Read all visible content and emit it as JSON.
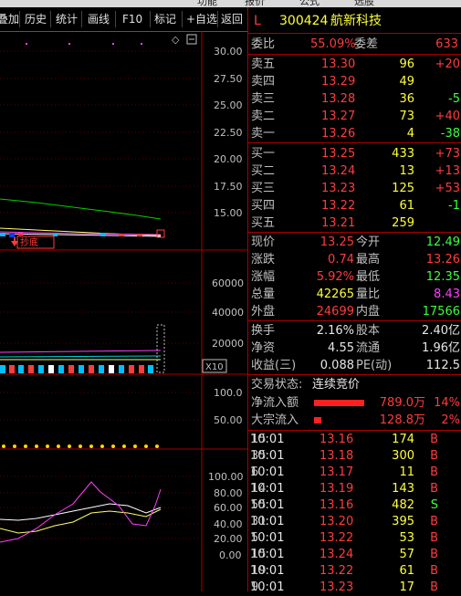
{
  "menu": {
    "items": [
      "功能",
      "报价",
      "公式",
      "选股"
    ]
  },
  "toolbar": {
    "buttons": [
      "叠加",
      "历史",
      "统计",
      "画线",
      "F10",
      "标记",
      "+自选",
      "返回"
    ]
  },
  "chart": {
    "price_ticks": [
      "30.00",
      "27.50",
      "25.00",
      "22.50",
      "20.00",
      "17.50",
      "15.00"
    ],
    "volume_ticks": [
      "60000",
      "40000",
      "20000"
    ],
    "volume_unit": "X10",
    "osc1_ticks": [
      "100.0",
      "50.00"
    ],
    "osc2_ticks": [
      "100.00",
      "80.00",
      "60.00",
      "40.00",
      "20.00",
      "0.00"
    ],
    "copy_bottom_label": "抄底",
    "colors": {
      "green_line": "#00d000",
      "yellow_line": "#ffff66",
      "magenta_line": "#ff40ff",
      "white_line": "#ffffff"
    }
  },
  "stock": {
    "flag": "L",
    "code": "300424",
    "name": "航新科技"
  },
  "order": {
    "weibi_label": "委比",
    "weibi_value": "55.09%",
    "weicha_label": "委差",
    "weicha_value": "633",
    "asks": [
      {
        "label": "卖五",
        "price": "13.30",
        "vol": "96",
        "chg": "+20"
      },
      {
        "label": "卖四",
        "price": "13.29",
        "vol": "49",
        "chg": ""
      },
      {
        "label": "卖三",
        "price": "13.28",
        "vol": "36",
        "chg": "-5"
      },
      {
        "label": "卖二",
        "price": "13.27",
        "vol": "73",
        "chg": "+40"
      },
      {
        "label": "卖一",
        "price": "13.26",
        "vol": "4",
        "chg": "-38"
      }
    ],
    "bids": [
      {
        "label": "买一",
        "price": "13.25",
        "vol": "433",
        "chg": "+73"
      },
      {
        "label": "买二",
        "price": "13.24",
        "vol": "13",
        "chg": "+13"
      },
      {
        "label": "买三",
        "price": "13.23",
        "vol": "125",
        "chg": "+53"
      },
      {
        "label": "买四",
        "price": "13.22",
        "vol": "61",
        "chg": "-1"
      },
      {
        "label": "买五",
        "price": "13.21",
        "vol": "259",
        "chg": ""
      }
    ]
  },
  "quote": [
    {
      "l1": "现价",
      "v1": "13.25",
      "l2": "今开",
      "v2": "12.49"
    },
    {
      "l1": "涨跌",
      "v1": "0.74",
      "l2": "最高",
      "v2": "13.26"
    },
    {
      "l1": "涨幅",
      "v1": "5.92%",
      "l2": "最低",
      "v2": "12.35"
    },
    {
      "l1": "总量",
      "v1": "42265",
      "l2": "量比",
      "v2": "8.43"
    },
    {
      "l1": "外盘",
      "v1": "24699",
      "l2": "内盘",
      "v2": "17566"
    }
  ],
  "fundamentals": [
    {
      "l1": "换手",
      "v1": "2.16%",
      "l2": "股本",
      "v2": "2.40亿"
    },
    {
      "l1": "净资",
      "v1": "4.55",
      "l2": "流通",
      "v2": "1.96亿"
    },
    {
      "l1": "收益(三)",
      "v1": "0.088",
      "l2": "PE(动)",
      "v2": "112.5"
    }
  ],
  "status": {
    "label": "交易状态:",
    "value": "连续竞价"
  },
  "flows": [
    {
      "label": "净流入额",
      "amount": "789.0万",
      "pct": "14%",
      "bar": 0.14
    },
    {
      "label": "大宗流入",
      "amount": "128.8万",
      "pct": "2%",
      "bar": 0.02
    }
  ],
  "ticks": [
    {
      "time": "10:01",
      "price": "13.16",
      "vol": "174",
      "side": "B",
      "n": "15"
    },
    {
      "time": "10:01",
      "price": "13.18",
      "vol": "300",
      "side": "B",
      "n": "35"
    },
    {
      "time": "10:01",
      "price": "13.17",
      "vol": "11",
      "side": "B",
      "n": "6"
    },
    {
      "time": "10:01",
      "price": "13.19",
      "vol": "143",
      "side": "B",
      "n": "14"
    },
    {
      "time": "10:01",
      "price": "13.16",
      "vol": "482",
      "side": "S",
      "n": "55"
    },
    {
      "time": "10:01",
      "price": "13.20",
      "vol": "395",
      "side": "B",
      "n": "31"
    },
    {
      "time": "10:01",
      "price": "13.22",
      "vol": "53",
      "side": "B",
      "n": "5"
    },
    {
      "time": "10:01",
      "price": "13.24",
      "vol": "57",
      "side": "B",
      "n": "15"
    },
    {
      "time": "10:01",
      "price": "13.22",
      "vol": "61",
      "side": "B",
      "n": "19"
    },
    {
      "time": "10:01",
      "price": "13.23",
      "vol": "17",
      "side": "B",
      "n": "9"
    }
  ]
}
